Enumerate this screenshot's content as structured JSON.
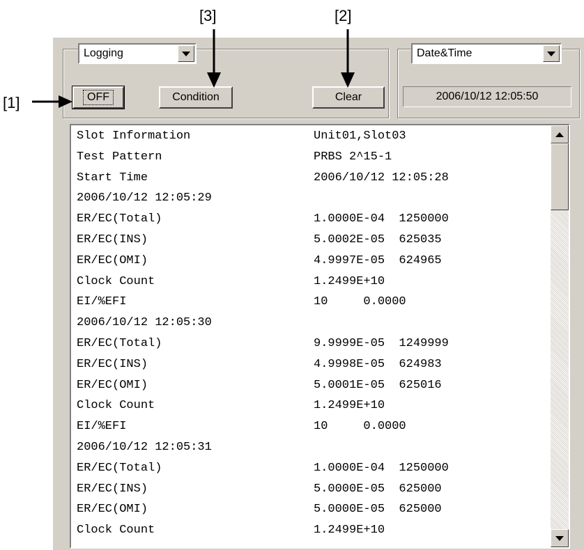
{
  "callouts": {
    "c1": "[1]",
    "c2": "[2]",
    "c3": "[3]"
  },
  "mode_combo": {
    "value": "Logging"
  },
  "time_combo": {
    "value": "Date&Time"
  },
  "buttons": {
    "off": "OFF",
    "condition": "Condition",
    "clear": "Clear"
  },
  "timestamp": "2006/10/12 12:05:50",
  "log_lines": [
    [
      "Slot Information",
      "Unit01,Slot03"
    ],
    [
      "Test Pattern",
      "PRBS 2^15-1"
    ],
    [
      "Start Time",
      "2006/10/12 12:05:28"
    ],
    [
      "2006/10/12 12:05:29",
      ""
    ],
    [
      "ER/EC(Total)",
      "1.0000E-04  1250000"
    ],
    [
      "ER/EC(INS)",
      "5.0002E-05  625035"
    ],
    [
      "ER/EC(OMI)",
      "4.9997E-05  624965"
    ],
    [
      "Clock Count",
      "1.2499E+10"
    ],
    [
      "EI/%EFI",
      "10     0.0000"
    ],
    [
      "2006/10/12 12:05:30",
      ""
    ],
    [
      "ER/EC(Total)",
      "9.9999E-05  1249999"
    ],
    [
      "ER/EC(INS)",
      "4.9998E-05  624983"
    ],
    [
      "ER/EC(OMI)",
      "5.0001E-05  625016"
    ],
    [
      "Clock Count",
      "1.2499E+10"
    ],
    [
      "EI/%EFI",
      "10     0.0000"
    ],
    [
      "2006/10/12 12:05:31",
      ""
    ],
    [
      "ER/EC(Total)",
      "1.0000E-04  1250000"
    ],
    [
      "ER/EC(INS)",
      "5.0000E-05  625000"
    ],
    [
      "ER/EC(OMI)",
      "5.0000E-05  625000"
    ],
    [
      "Clock Count",
      "1.2499E+10"
    ]
  ]
}
